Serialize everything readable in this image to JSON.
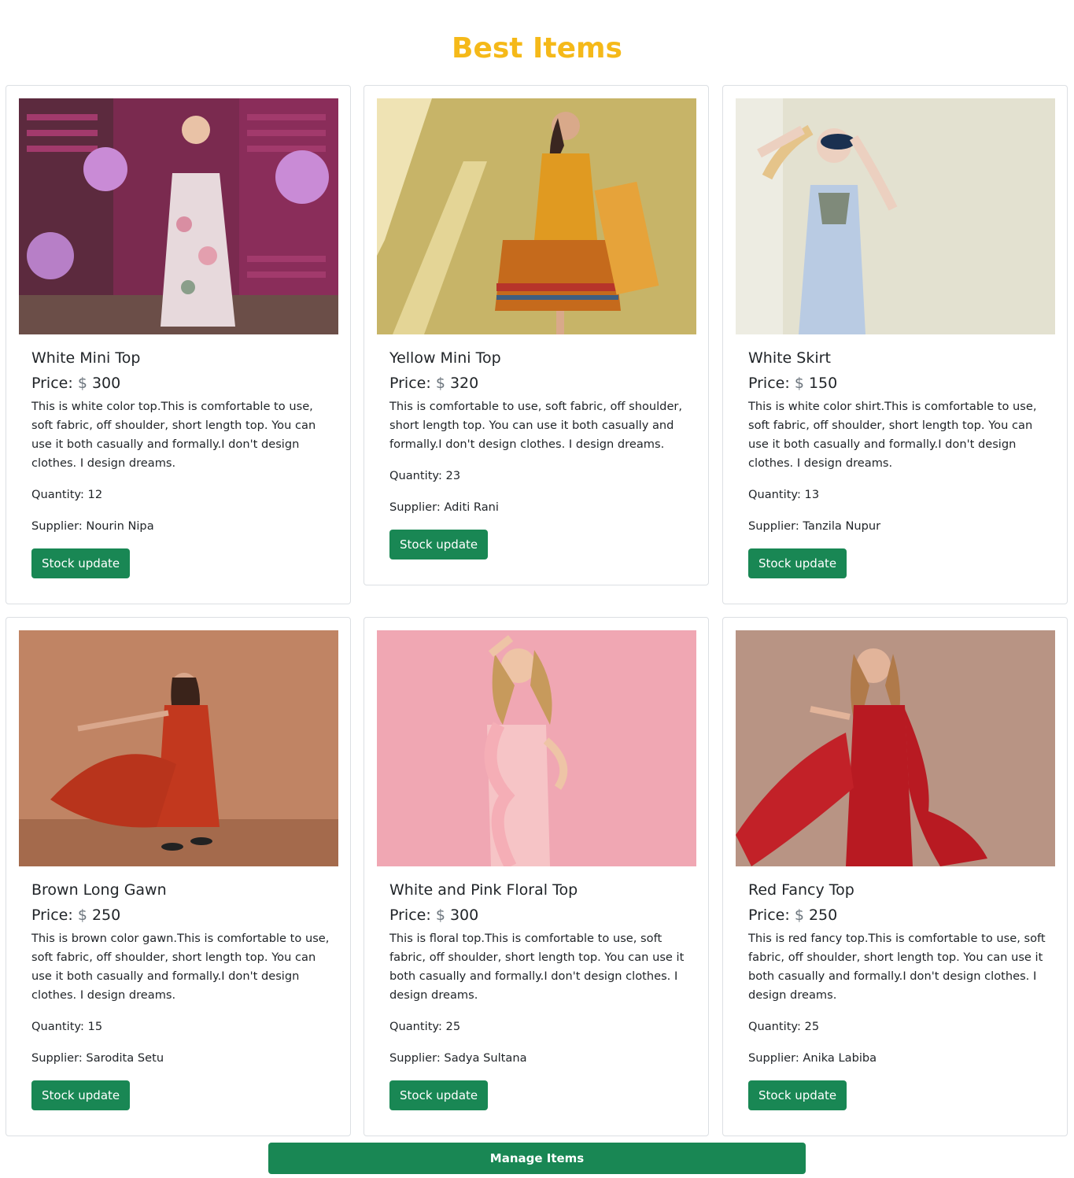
{
  "page": {
    "title": "Best Items",
    "title_color": "#f5b919",
    "accent": "#198754"
  },
  "items": [
    {
      "name": "White Mini Top",
      "price_label": "Price:",
      "currency": "$",
      "price": "300",
      "description": "This is white color top.This is comfortable to use, soft fabric, off shoulder, short length top. You can use it both casually and formally.I don't design clothes. I design dreams.",
      "quantity": "Quantity: 12",
      "supplier": "Supplier: Nourin Nipa",
      "button": "Stock update"
    },
    {
      "name": "Yellow Mini Top",
      "price_label": "Price:",
      "currency": "$",
      "price": "320",
      "description": "This is comfortable to use, soft fabric, off shoulder, short length top. You can use it both casually and formally.I don't design clothes. I design dreams.",
      "quantity": "Quantity: 23",
      "supplier": "Supplier: Aditi Rani",
      "button": "Stock update"
    },
    {
      "name": "White Skirt",
      "price_label": "Price:",
      "currency": "$",
      "price": "150",
      "description": "This is white color shirt.This is comfortable to use, soft fabric, off shoulder, short length top. You can use it both casually and formally.I don't design clothes. I design dreams.",
      "quantity": "Quantity: 13",
      "supplier": "Supplier: Tanzila Nupur",
      "button": "Stock update"
    },
    {
      "name": "Brown Long Gawn",
      "price_label": "Price:",
      "currency": "$",
      "price": "250",
      "description": "This is brown color gawn.This is comfortable to use, soft fabric, off shoulder, short length top. You can use it both casually and formally.I don't design clothes. I design dreams.",
      "quantity": "Quantity: 15",
      "supplier": "Supplier: Sarodita Setu",
      "button": "Stock update"
    },
    {
      "name": "White and Pink Floral Top",
      "price_label": "Price:",
      "currency": "$",
      "price": "300",
      "description": "This is floral top.This is comfortable to use, soft fabric, off shoulder, short length top. You can use it both casually and formally.I don't design clothes. I design dreams.",
      "quantity": "Quantity: 25",
      "supplier": "Supplier: Sadya Sultana",
      "button": "Stock update"
    },
    {
      "name": "Red Fancy Top",
      "price_label": "Price:",
      "currency": "$",
      "price": "250",
      "description": "This is red fancy top.This is comfortable to use, soft fabric, off shoulder, short length top. You can use it both casually and formally.I don't design clothes. I design dreams.",
      "quantity": "Quantity: 25",
      "supplier": "Supplier: Anika Labiba",
      "button": "Stock update"
    }
  ],
  "manage_button": "Manage Items"
}
